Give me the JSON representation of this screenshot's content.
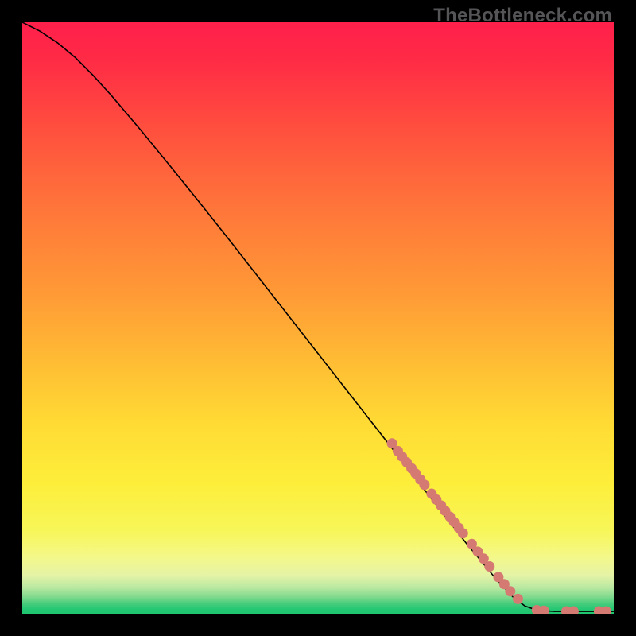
{
  "watermark": "TheBottleneck.com",
  "colors": {
    "frame": "#000000",
    "gradient_stops": [
      {
        "offset": 0.0,
        "color": "#ff1f4b"
      },
      {
        "offset": 0.06,
        "color": "#ff2a46"
      },
      {
        "offset": 0.18,
        "color": "#ff4f3e"
      },
      {
        "offset": 0.32,
        "color": "#ff773a"
      },
      {
        "offset": 0.46,
        "color": "#ff9a36"
      },
      {
        "offset": 0.58,
        "color": "#ffbe34"
      },
      {
        "offset": 0.68,
        "color": "#ffdb34"
      },
      {
        "offset": 0.78,
        "color": "#fdee3a"
      },
      {
        "offset": 0.86,
        "color": "#f7f659"
      },
      {
        "offset": 0.905,
        "color": "#f4f88a"
      },
      {
        "offset": 0.935,
        "color": "#e4f3a6"
      },
      {
        "offset": 0.956,
        "color": "#b9e8a1"
      },
      {
        "offset": 0.972,
        "color": "#7ed98d"
      },
      {
        "offset": 0.984,
        "color": "#42cc7b"
      },
      {
        "offset": 0.993,
        "color": "#23c772"
      },
      {
        "offset": 1.0,
        "color": "#20c66f"
      }
    ],
    "curve": "#000000",
    "marker_fill": "#d57a72",
    "marker_stroke": "#9a4f48"
  },
  "chart_data": {
    "type": "line",
    "title": "",
    "xlabel": "",
    "ylabel": "",
    "xlim": [
      0,
      100
    ],
    "ylim": [
      0,
      100
    ],
    "curve": [
      {
        "x": 0,
        "y": 100
      },
      {
        "x": 3,
        "y": 98.5
      },
      {
        "x": 6,
        "y": 96.5
      },
      {
        "x": 9,
        "y": 94.0
      },
      {
        "x": 12,
        "y": 91.0
      },
      {
        "x": 15,
        "y": 87.7
      },
      {
        "x": 20,
        "y": 81.8
      },
      {
        "x": 25,
        "y": 75.7
      },
      {
        "x": 30,
        "y": 69.5
      },
      {
        "x": 35,
        "y": 63.2
      },
      {
        "x": 40,
        "y": 56.8
      },
      {
        "x": 45,
        "y": 50.4
      },
      {
        "x": 50,
        "y": 44.0
      },
      {
        "x": 55,
        "y": 37.6
      },
      {
        "x": 60,
        "y": 31.2
      },
      {
        "x": 65,
        "y": 24.8
      },
      {
        "x": 70,
        "y": 18.4
      },
      {
        "x": 75,
        "y": 12.0
      },
      {
        "x": 80,
        "y": 6.0
      },
      {
        "x": 83,
        "y": 2.8
      },
      {
        "x": 85,
        "y": 1.3
      },
      {
        "x": 87,
        "y": 0.6
      },
      {
        "x": 90,
        "y": 0.4
      },
      {
        "x": 94,
        "y": 0.4
      },
      {
        "x": 100,
        "y": 0.4
      }
    ],
    "markers": [
      {
        "x": 62.5,
        "y": 28.8
      },
      {
        "x": 63.5,
        "y": 27.5
      },
      {
        "x": 64.2,
        "y": 26.6
      },
      {
        "x": 65.0,
        "y": 25.6
      },
      {
        "x": 65.8,
        "y": 24.6
      },
      {
        "x": 66.5,
        "y": 23.7
      },
      {
        "x": 67.3,
        "y": 22.7
      },
      {
        "x": 68.0,
        "y": 21.8
      },
      {
        "x": 69.2,
        "y": 20.3
      },
      {
        "x": 70.0,
        "y": 19.3
      },
      {
        "x": 70.8,
        "y": 18.3
      },
      {
        "x": 71.5,
        "y": 17.4
      },
      {
        "x": 72.3,
        "y": 16.4
      },
      {
        "x": 73.0,
        "y": 15.5
      },
      {
        "x": 73.8,
        "y": 14.5
      },
      {
        "x": 74.5,
        "y": 13.6
      },
      {
        "x": 76.0,
        "y": 11.8
      },
      {
        "x": 77.0,
        "y": 10.5
      },
      {
        "x": 78.0,
        "y": 9.3
      },
      {
        "x": 79.0,
        "y": 8.0
      },
      {
        "x": 80.5,
        "y": 6.2
      },
      {
        "x": 81.5,
        "y": 5.0
      },
      {
        "x": 82.5,
        "y": 3.8
      },
      {
        "x": 83.8,
        "y": 2.5
      },
      {
        "x": 87.0,
        "y": 0.6
      },
      {
        "x": 88.2,
        "y": 0.5
      },
      {
        "x": 92.0,
        "y": 0.4
      },
      {
        "x": 93.2,
        "y": 0.4
      },
      {
        "x": 97.5,
        "y": 0.4
      },
      {
        "x": 98.7,
        "y": 0.4
      }
    ]
  }
}
